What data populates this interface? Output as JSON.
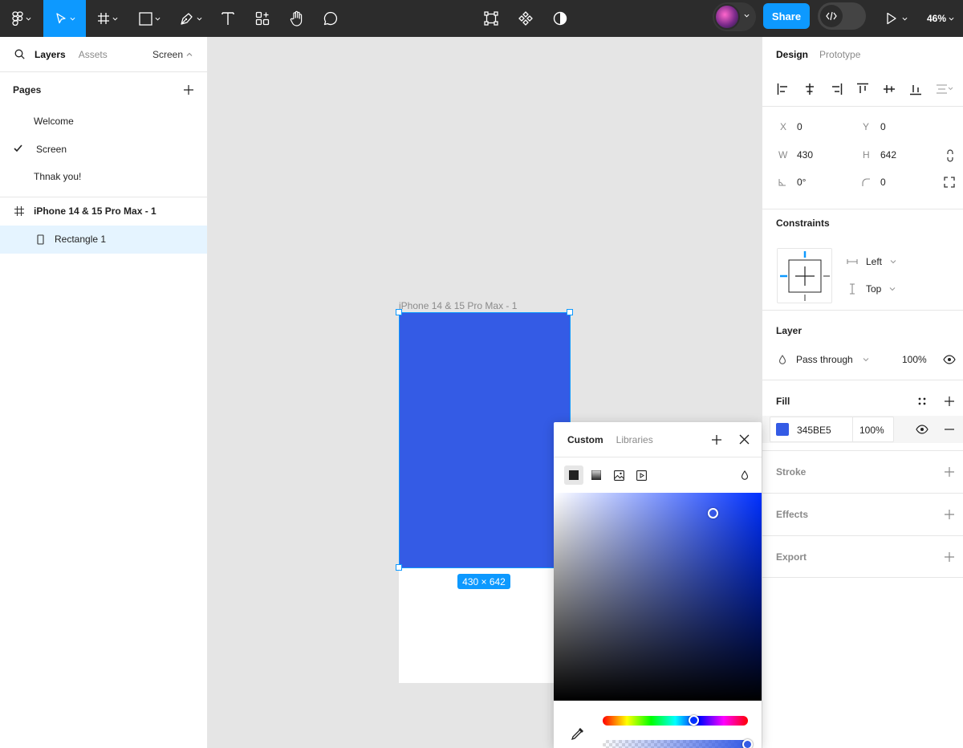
{
  "toolbar": {
    "share_label": "Share",
    "zoom": "46%",
    "tools": [
      "figma-menu",
      "move-tool",
      "frame-tool",
      "shape-tool",
      "pen-tool",
      "text-tool",
      "resources-tool",
      "hand-tool",
      "comment-tool"
    ]
  },
  "left_panel": {
    "tabs": [
      "Layers",
      "Assets"
    ],
    "active_tab": "Layers",
    "page_selector": "Screen",
    "pages_title": "Pages",
    "pages": [
      {
        "label": "Welcome",
        "selected": false
      },
      {
        "label": "Screen",
        "selected": true
      },
      {
        "label": "Thnak you!",
        "selected": false
      }
    ],
    "layers": [
      {
        "label": "iPhone 14 & 15 Pro Max - 1",
        "type": "frame"
      },
      {
        "label": "Rectangle 1",
        "type": "rectangle"
      }
    ]
  },
  "canvas": {
    "frame_label": "iPhone 14 & 15 Pro Max - 1",
    "size_badge": "430 × 642",
    "rect_color": "#345BE5"
  },
  "right_panel": {
    "tabs": [
      "Design",
      "Prototype"
    ],
    "active_tab": "Design",
    "x_label": "X",
    "x": "0",
    "y_label": "Y",
    "y": "0",
    "w_label": "W",
    "w": "430",
    "h_label": "H",
    "h": "642",
    "rotation": "0°",
    "radius": "0",
    "constraints_title": "Constraints",
    "constraint_h": "Left",
    "constraint_v": "Top",
    "layer_title": "Layer",
    "blend_mode": "Pass through",
    "layer_opacity": "100%",
    "fill_title": "Fill",
    "fill_hex": "345BE5",
    "fill_opacity": "100%",
    "fill_color": "#345BE5",
    "stroke_title": "Stroke",
    "effects_title": "Effects",
    "export_title": "Export"
  },
  "picker": {
    "tabs": [
      "Custom",
      "Libraries"
    ],
    "active_tab": "Custom",
    "hue_color": "#0030ff",
    "hue_fraction": 0.63,
    "saturation": 0.77,
    "value": 0.9,
    "alpha": 1.0
  }
}
